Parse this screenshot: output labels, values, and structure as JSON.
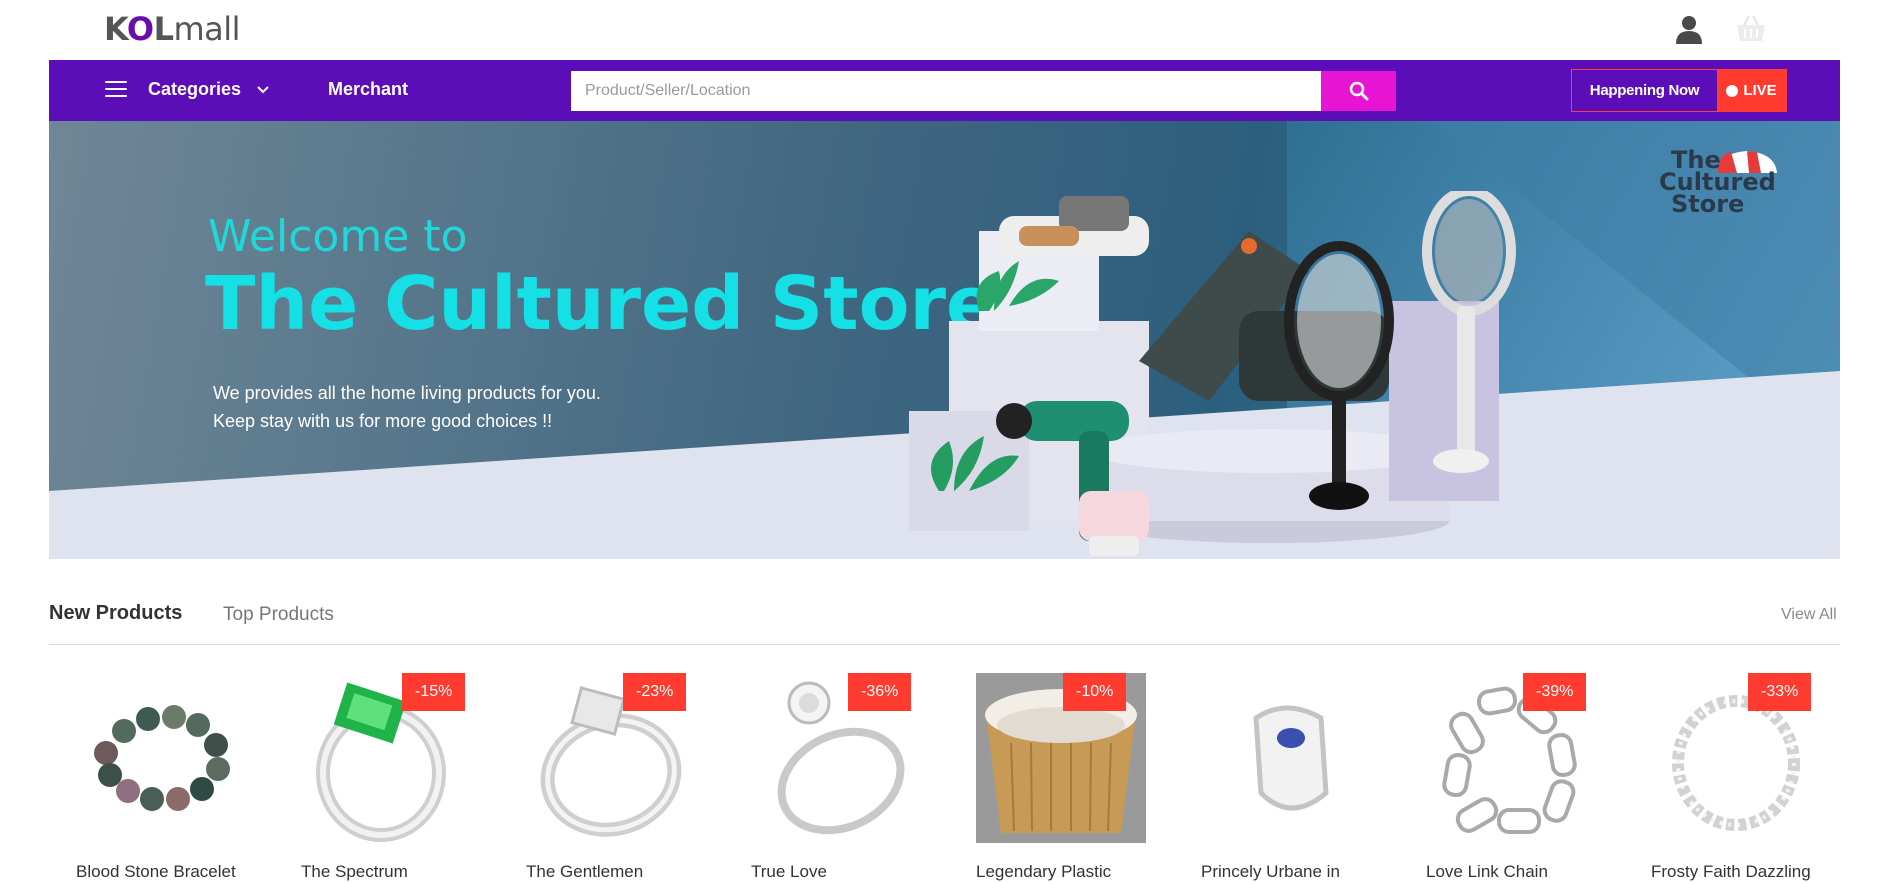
{
  "header": {
    "logo": "KOLmall",
    "logo_parts": [
      "K",
      "O",
      "L",
      "mall"
    ]
  },
  "nav": {
    "categories_label": "Categories",
    "merchant_label": "Merchant",
    "search_placeholder": "Product/Seller/Location",
    "happening_now_label": "Happening Now",
    "live_label": "LIVE"
  },
  "banner": {
    "welcome": "Welcome to",
    "title": "The Cultured Store",
    "tagline_line1": "We provides all the home living products for you.",
    "tagline_line2": "Keep stay with us for more good choices !!",
    "store_logo_line1": "The",
    "store_logo_line2": "Cultured",
    "store_logo_line3": "Store"
  },
  "tabs": {
    "new_products": "New Products",
    "top_products": "Top Products",
    "view_all": "View All"
  },
  "products": [
    {
      "name": "Blood Stone Bracelet",
      "discount": ""
    },
    {
      "name": "The Spectrum",
      "discount": "-15%"
    },
    {
      "name": "The Gentlemen",
      "discount": "-23%"
    },
    {
      "name": "True Love",
      "discount": "-36%"
    },
    {
      "name": "Legendary Plastic",
      "discount": "-10%"
    },
    {
      "name": "Princely Urbane in",
      "discount": ""
    },
    {
      "name": "Love Link Chain",
      "discount": "-39%"
    },
    {
      "name": "Frosty Faith Dazzling",
      "discount": "-33%"
    }
  ],
  "colors": {
    "nav_purple": "#5b0db8",
    "search_button": "#e814d4",
    "badge_red": "#ff3b30",
    "banner_title_cyan": "#14e0e6"
  }
}
